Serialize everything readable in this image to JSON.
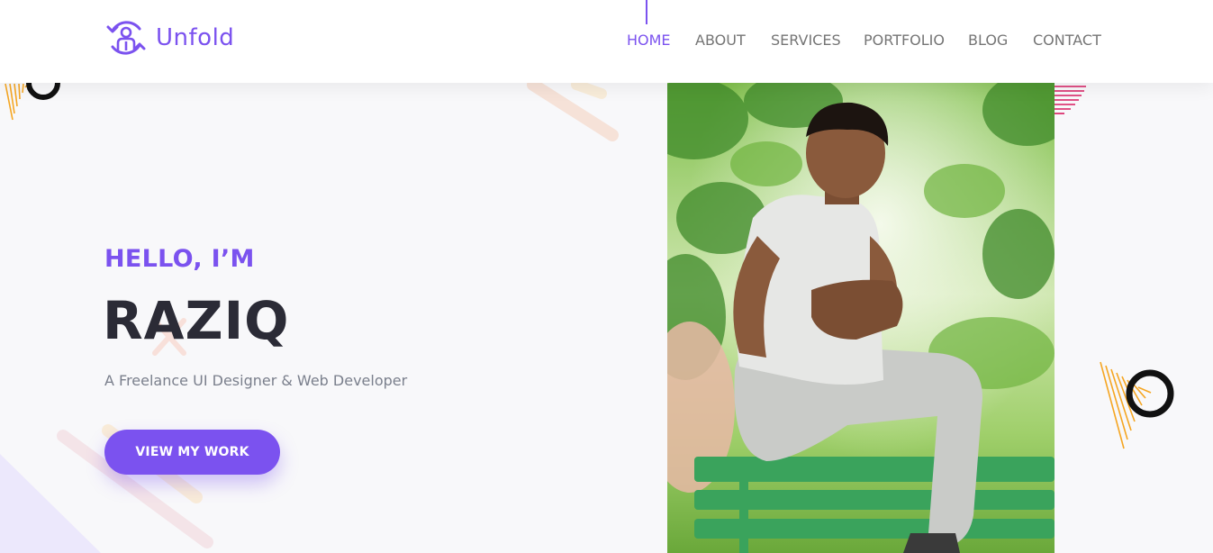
{
  "brand": {
    "name": "Unfold",
    "accent_color": "#7b52ef"
  },
  "nav": {
    "items": [
      {
        "label": "HOME",
        "active": true
      },
      {
        "label": "ABOUT",
        "active": false
      },
      {
        "label": "SERVICES",
        "active": false
      },
      {
        "label": "PORTFOLIO",
        "active": false
      },
      {
        "label": "BLOG",
        "active": false
      },
      {
        "label": "CONTACT",
        "active": false
      }
    ]
  },
  "hero": {
    "eyebrow": "HELLO, I’M",
    "name": "RAZIQ",
    "subtitle": "A Freelance UI Designer & Web Developer",
    "cta_label": "VIEW MY WORK"
  },
  "colors": {
    "heading": "#2b2b36",
    "muted": "#7a7f8c",
    "nav_text": "#757575",
    "decor_orange": "#f5a623",
    "decor_pink": "#d81b60"
  }
}
